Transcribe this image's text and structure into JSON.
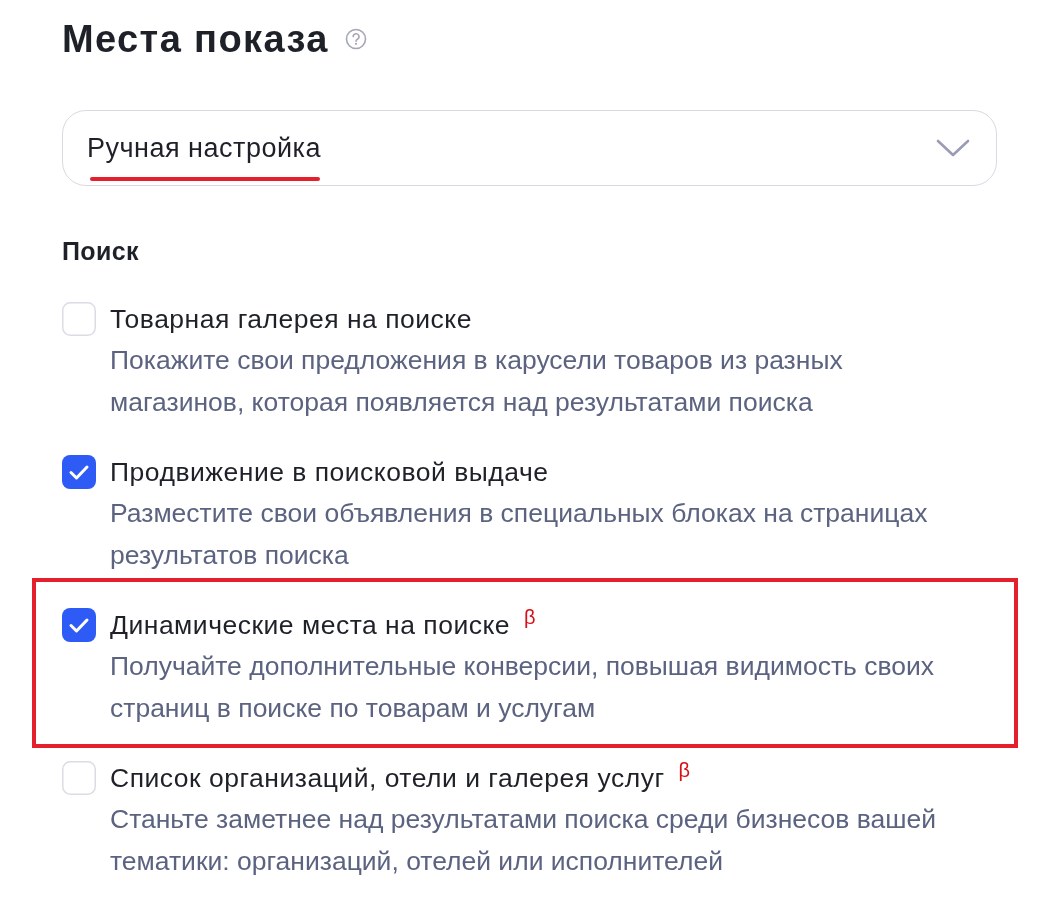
{
  "title": "Места показа",
  "placement_select": {
    "value": "Ручная настройка",
    "underlined": true
  },
  "sections": [
    {
      "heading": "Поиск",
      "options": [
        {
          "label": "Товарная галерея на поиске",
          "description_lines": [
            "Покажите свои предложения в карусели товаров из разных",
            "магазинов, которая появляется над результатами поиска"
          ],
          "checked": false,
          "highlighted": false
        },
        {
          "label": "Продвижение в поисковой выдаче",
          "description_lines": [
            "Разместите свои объявления в специальных блоках на страницах",
            "результатов поиска"
          ],
          "checked": true,
          "highlighted": false
        },
        {
          "label": "Динамические места на поиске",
          "beta_mark": "β",
          "description_lines": [
            "Получайте дополнительные конверсии, повышая видимость своих",
            "страниц в поиске по товарам и услугам"
          ],
          "checked": true,
          "highlighted": true
        },
        {
          "label": "Список организаций, отели и галерея услуг",
          "beta_mark": "β",
          "description_lines": [
            "Станьте заметнее над результатами поиска среди бизнесов вашей",
            "тематики: организаций, отелей или исполнителей"
          ],
          "checked": false,
          "highlighted": false
        }
      ]
    }
  ]
}
